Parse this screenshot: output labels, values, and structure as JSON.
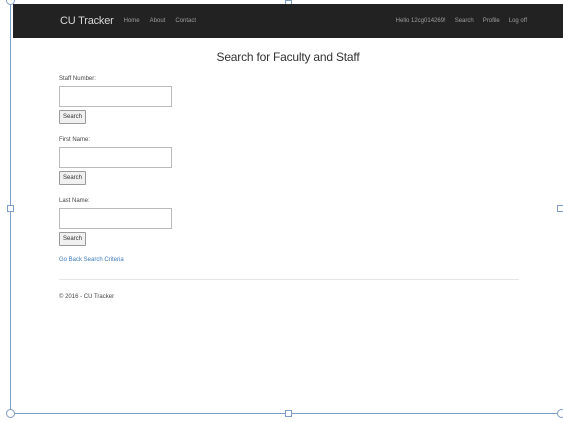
{
  "navbar": {
    "brand": "CU Tracker",
    "links": [
      "Home",
      "About",
      "Contact"
    ],
    "greeting": "Hello 12cg014269!",
    "right_links": [
      "Search",
      "Profile",
      "Log off"
    ],
    "background": "#222222"
  },
  "page": {
    "title": "Search for Faculty and Staff"
  },
  "form": {
    "staff_number_label": "Staff Number:",
    "staff_number_value": "",
    "first_name_label": "First Name:",
    "first_name_value": "",
    "last_name_label": "Last Name:",
    "last_name_value": "",
    "search_label": "Search",
    "back_link": "Go Back Search Criteria"
  },
  "footer": {
    "text": "© 2016 - CU Tracker"
  },
  "colors": {
    "link": "#3b7bbf",
    "selection_frame": "#7d9cc6"
  }
}
